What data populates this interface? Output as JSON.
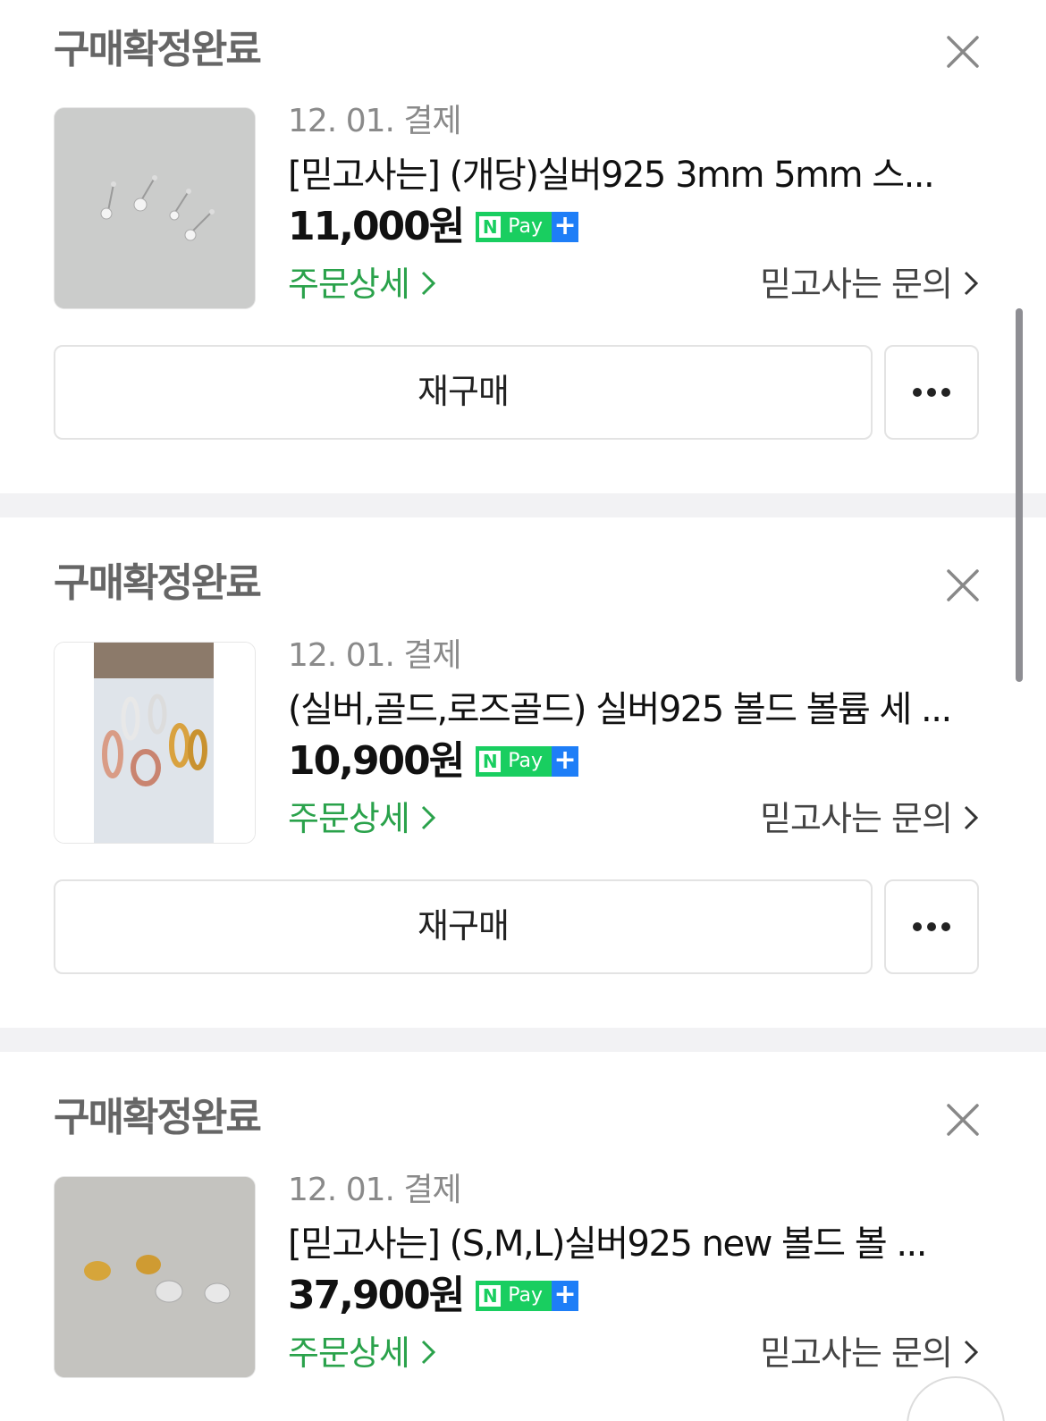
{
  "orders": [
    {
      "status": "구매확정완료",
      "date": "12. 01. 결제",
      "title": "[믿고사는] (개당)실버925 3mm 5mm 스...",
      "price": "11,000원",
      "detail_link": "주문상세",
      "inquiry_link": "믿고사는 문의",
      "rebuy_label": "재구매"
    },
    {
      "status": "구매확정완료",
      "date": "12. 01. 결제",
      "title": "(실버,골드,로즈골드) 실버925 볼드 볼륨 세 ...",
      "price": "10,900원",
      "detail_link": "주문상세",
      "inquiry_link": "믿고사는 문의",
      "rebuy_label": "재구매"
    },
    {
      "status": "구매확정완료",
      "date": "12. 01. 결제",
      "title": "[믿고사는] (S,M,L)실버925 new 볼드 볼 ...",
      "price": "37,900원",
      "detail_link": "주문상세",
      "inquiry_link": "믿고사는 문의",
      "rebuy_label": null
    }
  ],
  "npay": {
    "n": "N",
    "pay": "Pay",
    "plus": "+"
  },
  "colors": {
    "detail_link": "#2aa24b",
    "npay_green": "#19ce60",
    "npay_blue": "#1e7ef7",
    "separator": "#f2f2f4"
  },
  "icons": [
    "close-icon",
    "chevron-right-icon",
    "more-dots-icon"
  ]
}
